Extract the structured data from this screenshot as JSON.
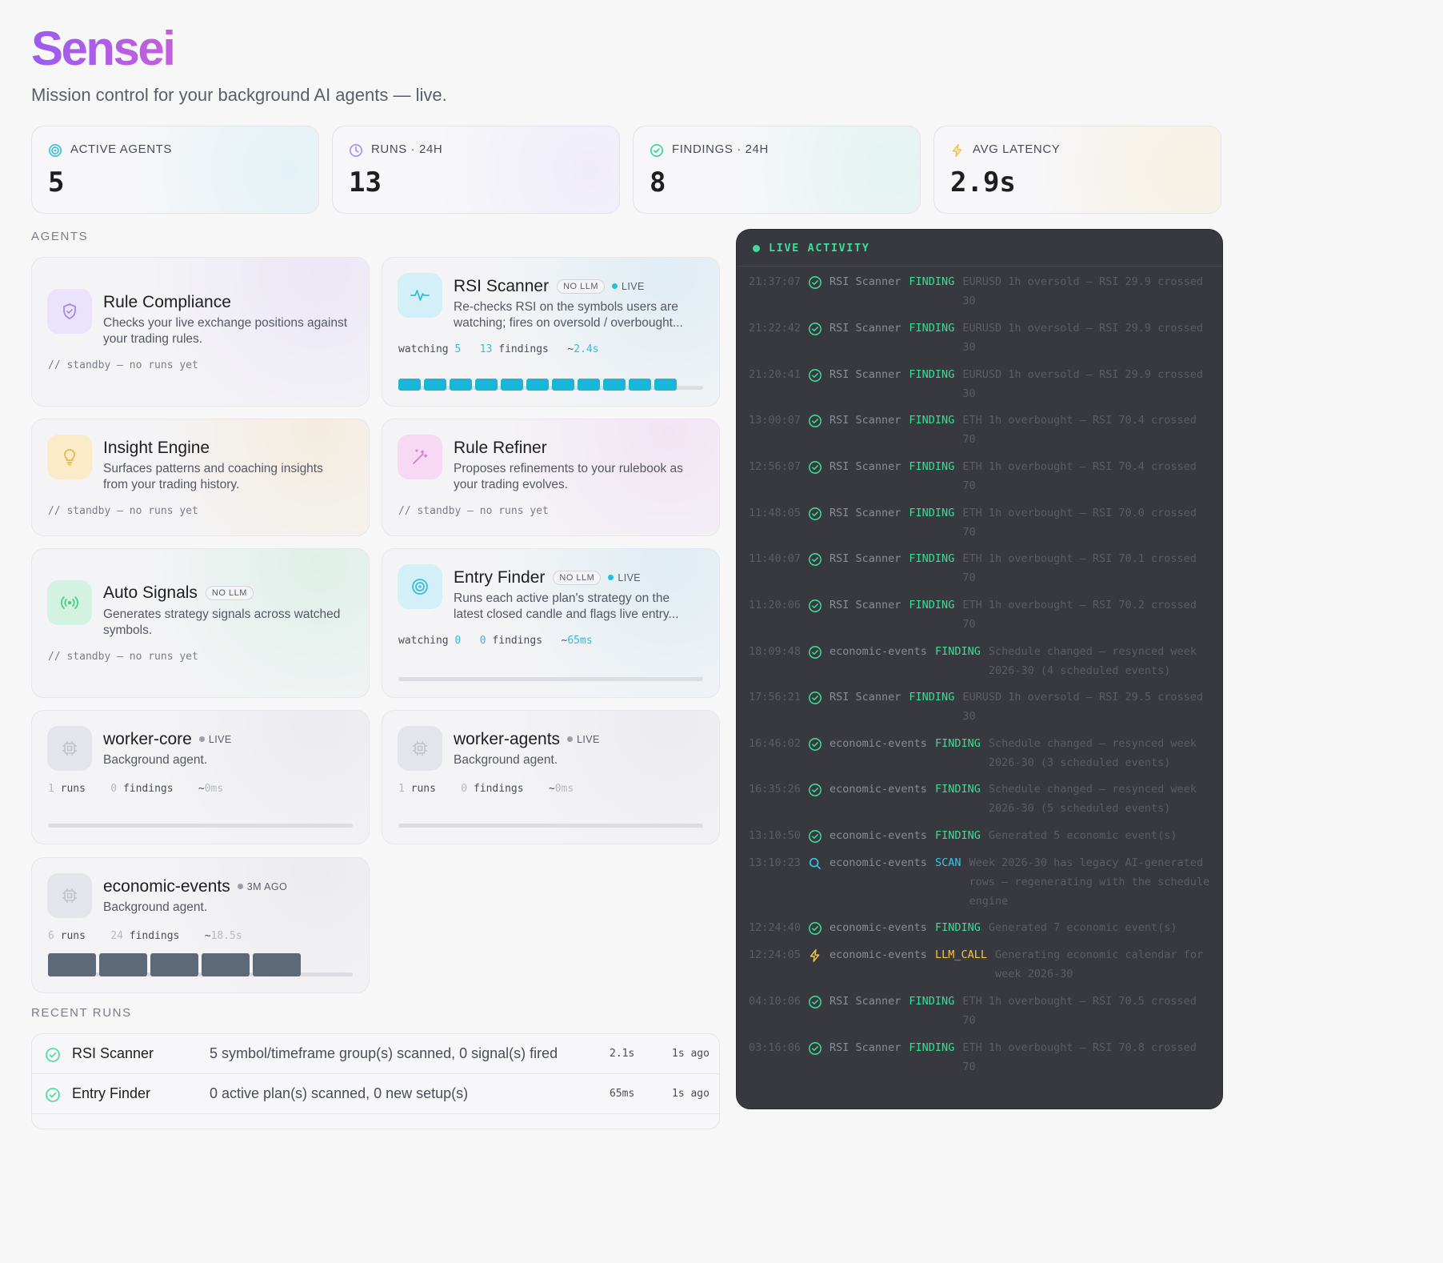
{
  "app": {
    "title": "Sensei",
    "tagline": "Mission control for your background AI agents — live."
  },
  "stats": [
    {
      "label": "ACTIVE AGENTS",
      "value": "5",
      "icon": "target-icon",
      "color": "#38bdd8"
    },
    {
      "label": "RUNS · 24H",
      "value": "13",
      "icon": "clock-icon",
      "color": "#a78bfa"
    },
    {
      "label": "FINDINGS · 24H",
      "value": "8",
      "icon": "check-circle-icon",
      "color": "#34d399"
    },
    {
      "label": "AVG LATENCY",
      "value": "2.9s",
      "icon": "bolt-icon",
      "color": "#f5c542"
    }
  ],
  "sections": {
    "agents": "AGENTS",
    "recent_runs": "RECENT RUNS"
  },
  "agents": {
    "rule_compliance": {
      "name": "Rule Compliance",
      "desc": "Checks your live exchange positions against your trading rules.",
      "standby": "// standby — no runs yet",
      "icon": "shield-icon"
    },
    "rsi_scanner": {
      "name": "RSI Scanner",
      "badge": "NO LLM",
      "status": "LIVE",
      "desc": "Re-checks RSI on the symbols users are watching; fires on oversold / overbought...",
      "watching_label": "watching",
      "watching": "5",
      "findings_n": "13",
      "findings_label": "findings",
      "latency": "2.4s",
      "icon": "pulse-icon",
      "activity_bars": 11
    },
    "insight_engine": {
      "name": "Insight Engine",
      "desc": "Surfaces patterns and coaching insights from your trading history.",
      "standby": "// standby — no runs yet",
      "icon": "lightbulb-icon"
    },
    "rule_refiner": {
      "name": "Rule Refiner",
      "desc": "Proposes refinements to your rulebook as your trading evolves.",
      "standby": "// standby — no runs yet",
      "icon": "magic-wand-icon"
    },
    "auto_signals": {
      "name": "Auto Signals",
      "badge": "NO LLM",
      "desc": "Generates strategy signals across watched symbols.",
      "standby": "// standby — no runs yet",
      "icon": "broadcast-icon"
    },
    "entry_finder": {
      "name": "Entry Finder",
      "badge": "NO LLM",
      "status": "LIVE",
      "desc": "Runs each active plan's strategy on the latest closed candle and flags live entry...",
      "watching_label": "watching",
      "watching": "0",
      "findings_n": "0",
      "findings_label": "findings",
      "latency": "65ms",
      "icon": "target-icon"
    },
    "worker_core": {
      "name": "worker-core",
      "status": "LIVE",
      "desc": "Background agent.",
      "runs_n": "1",
      "runs_label": "runs",
      "findings_n": "0",
      "findings_label": "findings",
      "latency": "0ms",
      "icon": "chip-icon"
    },
    "worker_agents": {
      "name": "worker-agents",
      "status": "LIVE",
      "desc": "Background agent.",
      "runs_n": "1",
      "runs_label": "runs",
      "findings_n": "0",
      "findings_label": "findings",
      "latency": "0ms",
      "icon": "chip-icon"
    },
    "economic_events": {
      "name": "economic-events",
      "status": "3M AGO",
      "desc": "Background agent.",
      "runs_n": "6",
      "runs_label": "runs",
      "findings_n": "24",
      "findings_label": "findings",
      "latency": "18.5s",
      "icon": "chip-icon",
      "activity_bars": 5
    }
  },
  "recent_runs": [
    {
      "agent": "RSI Scanner",
      "summary": "5 symbol/timeframe group(s) scanned, 0 signal(s) fired",
      "duration": "2.1s",
      "ago": "1s ago",
      "icon": "check-circle-icon"
    },
    {
      "agent": "Entry Finder",
      "summary": "0 active plan(s) scanned, 0 new setup(s)",
      "duration": "65ms",
      "ago": "1s ago",
      "icon": "check-circle-icon"
    }
  ],
  "activity": {
    "title": "LIVE ACTIVITY",
    "events": [
      {
        "time": "21:37:07",
        "agent": "RSI Scanner",
        "type": "FINDING",
        "l1": "EURUSD 1h oversold — RSI 29.9 crossed",
        "l2": "30",
        "icon": "check-circle-icon"
      },
      {
        "time": "21:22:42",
        "agent": "RSI Scanner",
        "type": "FINDING",
        "l1": "EURUSD 1h oversold — RSI 29.9 crossed",
        "l2": "30",
        "icon": "check-circle-icon"
      },
      {
        "time": "21:20:41",
        "agent": "RSI Scanner",
        "type": "FINDING",
        "l1": "EURUSD 1h oversold — RSI 29.9 crossed",
        "l2": "30",
        "icon": "check-circle-icon"
      },
      {
        "time": "13:00:07",
        "agent": "RSI Scanner",
        "type": "FINDING",
        "l1": "ETH 1h overbought — RSI 70.4 crossed",
        "l2": "70",
        "icon": "check-circle-icon"
      },
      {
        "time": "12:56:07",
        "agent": "RSI Scanner",
        "type": "FINDING",
        "l1": "ETH 1h overbought — RSI 70.4 crossed",
        "l2": "70",
        "icon": "check-circle-icon"
      },
      {
        "time": "11:48:05",
        "agent": "RSI Scanner",
        "type": "FINDING",
        "l1": "ETH 1h overbought — RSI 70.0 crossed",
        "l2": "70",
        "icon": "check-circle-icon"
      },
      {
        "time": "11:40:07",
        "agent": "RSI Scanner",
        "type": "FINDING",
        "l1": "ETH 1h overbought — RSI 70.1 crossed",
        "l2": "70",
        "icon": "check-circle-icon"
      },
      {
        "time": "11:20:06",
        "agent": "RSI Scanner",
        "type": "FINDING",
        "l1": "ETH 1h overbought — RSI 70.2 crossed",
        "l2": "70",
        "icon": "check-circle-icon"
      },
      {
        "time": "18:09:48",
        "agent": "economic-events",
        "type": "FINDING",
        "l1": "Schedule changed — resynced week",
        "l2": "2026-30 (4 scheduled events)",
        "icon": "check-circle-icon"
      },
      {
        "time": "17:56:21",
        "agent": "RSI Scanner",
        "type": "FINDING",
        "l1": "EURUSD 1h oversold — RSI 29.5 crossed",
        "l2": "30",
        "icon": "check-circle-icon"
      },
      {
        "time": "16:46:02",
        "agent": "economic-events",
        "type": "FINDING",
        "l1": "Schedule changed — resynced week",
        "l2": "2026-30 (3 scheduled events)",
        "icon": "check-circle-icon"
      },
      {
        "time": "16:35:26",
        "agent": "economic-events",
        "type": "FINDING",
        "l1": "Schedule changed — resynced week",
        "l2": "2026-30 (5 scheduled events)",
        "icon": "check-circle-icon"
      },
      {
        "time": "13:10:50",
        "agent": "economic-events",
        "type": "FINDING",
        "l1": "Generated 5 economic event(s)",
        "icon": "check-circle-icon"
      },
      {
        "time": "13:10:23",
        "agent": "economic-events",
        "type": "SCAN",
        "l1": "Week 2026-30 has legacy AI-generated",
        "l2": "rows — regenerating with the schedule",
        "l3": "engine",
        "icon": "search-icon"
      },
      {
        "time": "12:24:40",
        "agent": "economic-events",
        "type": "FINDING",
        "l1": "Generated 7 economic event(s)",
        "icon": "check-circle-icon"
      },
      {
        "time": "12:24:05",
        "agent": "economic-events",
        "type": "LLM_CALL",
        "l1": "Generating economic calendar for",
        "l2": "week 2026-30",
        "icon": "bolt-icon"
      },
      {
        "time": "04:10:06",
        "agent": "RSI Scanner",
        "type": "FINDING",
        "l1": "ETH 1h overbought — RSI 70.5 crossed",
        "l2": "70",
        "icon": "check-circle-icon"
      },
      {
        "time": "03:16:06",
        "agent": "RSI Scanner",
        "type": "FINDING",
        "l1": "ETH 1h overbought — RSI 70.8 crossed",
        "l2": "70",
        "icon": "check-circle-icon"
      }
    ]
  },
  "colors": {
    "finding": "#3ddc97",
    "scan": "#36c5e8",
    "llm_call": "#f5c542",
    "accent_cyan": "#1ab6d8",
    "slate_bar": "#5d6878"
  }
}
